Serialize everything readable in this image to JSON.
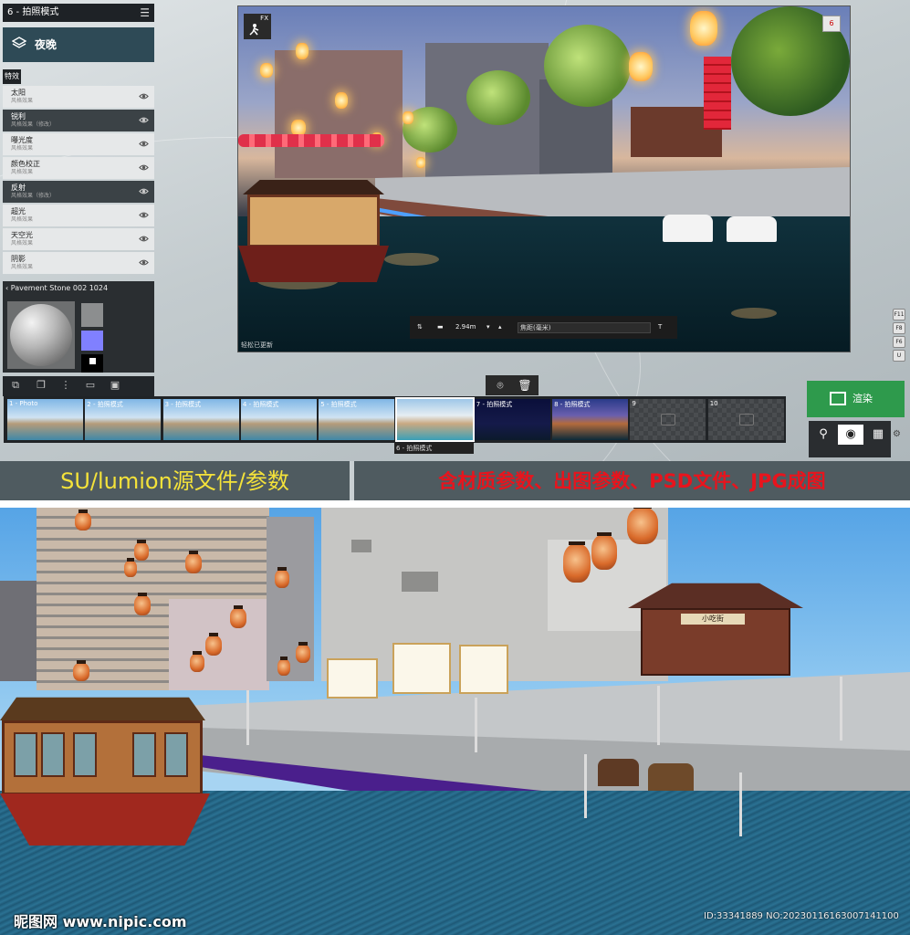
{
  "panel": {
    "title": "6 - 拍照模式",
    "menu_icon": "hamburger-icon",
    "preset": "夜晚",
    "tab": "特效",
    "effects": [
      {
        "name": "太阳",
        "sub": "风格效果",
        "active": false
      },
      {
        "name": "锐利",
        "sub": "风格效果（修改）",
        "active": true
      },
      {
        "name": "曝光度",
        "sub": "风格效果",
        "active": false
      },
      {
        "name": "颜色校正",
        "sub": "风格效果",
        "active": false
      },
      {
        "name": "反射",
        "sub": "风格效果（修改）",
        "active": true
      },
      {
        "name": "超光",
        "sub": "风格效果",
        "active": false
      },
      {
        "name": "天空光",
        "sub": "风格效果",
        "active": false
      },
      {
        "name": "阴影",
        "sub": "风格效果",
        "active": false
      }
    ],
    "material": {
      "title": "Pavement Stone 002 1024"
    }
  },
  "viewport": {
    "fx_label": "FX",
    "badge": "6",
    "distance": "2.94m",
    "focus_label": "焦距(毫米)",
    "status": "轻松已更新"
  },
  "fkeys": [
    "F11",
    "F8",
    "F6",
    "U"
  ],
  "thumbnails": [
    {
      "label": "1 - Photo",
      "kind": "day"
    },
    {
      "label": "2 - 拍照模式",
      "kind": "day"
    },
    {
      "label": "3 - 拍照模式",
      "kind": "day"
    },
    {
      "label": "4 - 拍照模式",
      "kind": "day"
    },
    {
      "label": "5 - 拍照模式",
      "kind": "day"
    },
    {
      "label": "",
      "kind": "selected"
    },
    {
      "label": "7 - 拍照模式",
      "kind": "night"
    },
    {
      "label": "8 - 拍照模式",
      "kind": "night2"
    },
    {
      "label": "9",
      "kind": "empty"
    },
    {
      "label": "10",
      "kind": "empty"
    }
  ],
  "selected_thumb_label": "6 - 拍照模式",
  "render_button": "渲染",
  "banner": {
    "left": "SU/lumion源文件/参数",
    "right": "含材质参数、出图参数、PSD文件、JPG成图"
  },
  "scene": {
    "shop_sign": "小吃街"
  },
  "watermark": {
    "left": "昵图网 www.nipic.com",
    "right": "ID:33341889 NO:20230116163007141100"
  },
  "colors": {
    "render_green": "#2e9a4c",
    "banner_yellow": "#f4e23a",
    "banner_red": "#e8141d",
    "panel_dark": "#2e4a56"
  }
}
